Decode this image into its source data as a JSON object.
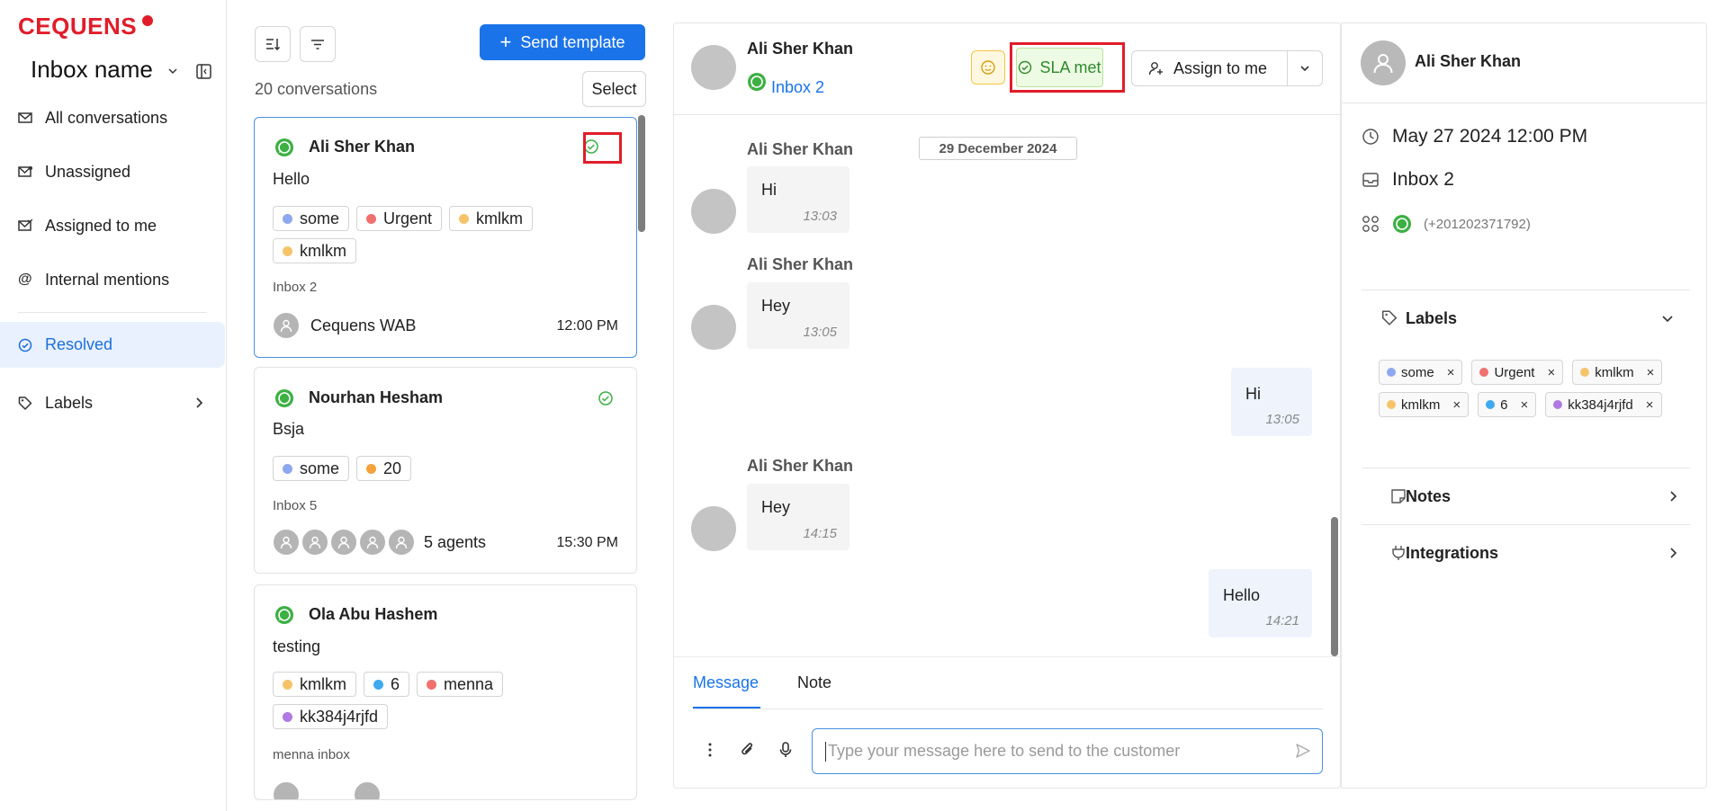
{
  "brand": {
    "logo_text": "CEQUENS",
    "logo_color": "#e11d2a"
  },
  "sidebar": {
    "inbox_name": "Inbox name",
    "items": [
      {
        "label": "All conversations",
        "icon": "mail-icon"
      },
      {
        "label": "Unassigned",
        "icon": "mail-unassigned-icon"
      },
      {
        "label": "Assigned to me",
        "icon": "mail-assigned-icon"
      },
      {
        "label": "Internal mentions",
        "icon": "at-icon"
      },
      {
        "label": "Resolved",
        "icon": "check-circle-icon",
        "active": true
      },
      {
        "label": "Labels",
        "icon": "tag-icon"
      }
    ]
  },
  "list": {
    "send_template_label": "Send template",
    "count_text": "20 conversations",
    "select_label": "Select",
    "conversations": [
      {
        "name": "Ali Sher Khan",
        "message": "Hello",
        "labels": [
          {
            "text": "some",
            "color": "#8ea8f0"
          },
          {
            "text": "Urgent",
            "color": "#f07070"
          },
          {
            "text": "kmlkm",
            "color": "#f5c46a"
          },
          {
            "text": "kmlkm",
            "color": "#f5c46a"
          }
        ],
        "inbox": "Inbox 2",
        "assignee": "Cequens WAB",
        "time": "12:00 PM"
      },
      {
        "name": "Nourhan Hesham",
        "message": "Bsja",
        "labels": [
          {
            "text": "some",
            "color": "#8ea8f0"
          },
          {
            "text": "20",
            "color": "#f5a23a"
          }
        ],
        "inbox": "Inbox 5",
        "assignee": "5 agents",
        "time": "15:30 PM"
      },
      {
        "name": "Ola Abu Hashem",
        "message": "testing",
        "labels": [
          {
            "text": "kmlkm",
            "color": "#f5c46a"
          },
          {
            "text": "6",
            "color": "#3fa9f0"
          },
          {
            "text": "menna",
            "color": "#f07070"
          },
          {
            "text": "kk384j4rjfd",
            "color": "#b07ae0"
          }
        ],
        "inbox": "menna inbox",
        "assignee": "",
        "time": ""
      }
    ]
  },
  "chat": {
    "header_name": "Ali Sher Khan",
    "header_inbox": "Inbox 2",
    "sla_label": "SLA met",
    "assign_label": "Assign to me",
    "date_divider": "29 December 2024",
    "messages": [
      {
        "sender": "Ali Sher Khan",
        "text": "Hi",
        "time": "13:03",
        "dir": "in"
      },
      {
        "sender": "Ali Sher Khan",
        "text": "Hey",
        "time": "13:05",
        "dir": "in"
      },
      {
        "sender": "",
        "text": "Hi",
        "time": "13:05",
        "dir": "out"
      },
      {
        "sender": "Ali Sher Khan",
        "text": "Hey",
        "time": "14:15",
        "dir": "in"
      },
      {
        "sender": "",
        "text": "Hello",
        "time": "14:21",
        "dir": "out"
      }
    ],
    "tabs": [
      "Message",
      "Note"
    ],
    "composer_placeholder": "Type your message here to send to the customer"
  },
  "contact": {
    "name": "Ali Sher Khan",
    "date": "May 27 2024 12:00 PM",
    "inbox": "Inbox 2",
    "phone": "(+201202371792)",
    "labels_title": "Labels",
    "labels": [
      {
        "text": "some",
        "color": "#8ea8f0"
      },
      {
        "text": "Urgent",
        "color": "#f07070"
      },
      {
        "text": "kmlkm",
        "color": "#f5c46a"
      },
      {
        "text": "kmlkm",
        "color": "#f5c46a"
      },
      {
        "text": "6",
        "color": "#3fa9f0"
      },
      {
        "text": "kk384j4rjfd",
        "color": "#b07ae0"
      }
    ],
    "notes_title": "Notes",
    "integrations_title": "Integrations"
  }
}
